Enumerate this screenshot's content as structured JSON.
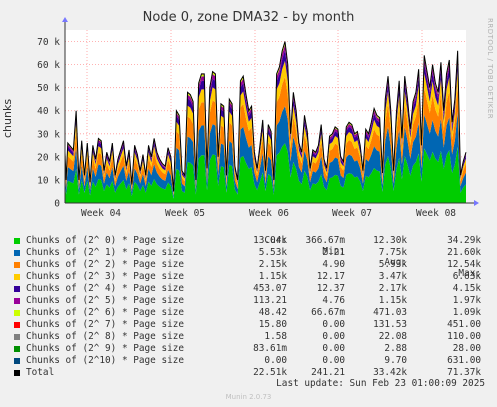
{
  "chart_data": {
    "type": "area",
    "title": "Node 0, zone DMA32 - by month",
    "ylabel": "chunks",
    "xlabels": [
      "Week 04",
      "Week 05",
      "Week 06",
      "Week 07",
      "Week 08"
    ],
    "yticks": [
      "0",
      "10 k",
      "20 k",
      "30 k",
      "40 k",
      "50 k",
      "60 k",
      "70 k"
    ],
    "ylim": [
      0,
      75000
    ],
    "grid": true,
    "stacked": true,
    "legend_headers": [
      "Cur:",
      "Min:",
      "Avg:",
      "Max:"
    ],
    "totals_peaks": [
      [
        0,
        22000
      ],
      [
        0.4,
        10000
      ],
      [
        1,
        26000
      ],
      [
        3,
        23000
      ],
      [
        4,
        40000
      ],
      [
        5,
        10000
      ],
      [
        6,
        27000
      ],
      [
        7,
        12000
      ],
      [
        8,
        26000
      ],
      [
        9,
        9000
      ],
      [
        9.6,
        19000
      ],
      [
        10,
        25000
      ],
      [
        11,
        19000
      ],
      [
        12,
        28000
      ],
      [
        13,
        27000
      ],
      [
        14,
        14000
      ],
      [
        15,
        22000
      ],
      [
        16,
        18000
      ],
      [
        17,
        26000
      ],
      [
        18,
        12000
      ],
      [
        19,
        19000
      ],
      [
        20,
        23000
      ],
      [
        21,
        27000
      ],
      [
        22,
        16000
      ],
      [
        23,
        23000
      ],
      [
        24,
        8000
      ],
      [
        25,
        25000
      ],
      [
        26,
        21000
      ],
      [
        27,
        14000
      ],
      [
        28,
        21000
      ],
      [
        29,
        12000
      ],
      [
        30,
        25000
      ],
      [
        31,
        20000
      ],
      [
        32,
        28000
      ],
      [
        33,
        22000
      ],
      [
        34,
        19000
      ],
      [
        35,
        17000
      ],
      [
        36,
        16000
      ],
      [
        37,
        24000
      ],
      [
        38,
        20000
      ],
      [
        39,
        5000
      ],
      [
        40,
        40000
      ],
      [
        41,
        38000
      ],
      [
        42,
        14000
      ],
      [
        43,
        12000
      ],
      [
        44,
        48000
      ],
      [
        45,
        47000
      ],
      [
        46,
        44000
      ],
      [
        47,
        10000
      ],
      [
        48,
        52000
      ],
      [
        49,
        56000
      ],
      [
        50,
        56000
      ],
      [
        51,
        15000
      ],
      [
        52,
        50000
      ],
      [
        53,
        57000
      ],
      [
        54,
        56000
      ],
      [
        55,
        20000
      ],
      [
        56,
        43000
      ],
      [
        57,
        42000
      ],
      [
        58,
        12000
      ],
      [
        59,
        45000
      ],
      [
        60,
        43000
      ],
      [
        61,
        16000
      ],
      [
        62,
        10000
      ],
      [
        63,
        53000
      ],
      [
        64,
        55000
      ],
      [
        65,
        47000
      ],
      [
        66,
        40000
      ],
      [
        67,
        42000
      ],
      [
        68,
        22000
      ],
      [
        69,
        15000
      ],
      [
        70,
        25000
      ],
      [
        71,
        36000
      ],
      [
        72,
        14000
      ],
      [
        73,
        34000
      ],
      [
        74,
        31000
      ],
      [
        75,
        10000
      ],
      [
        76,
        56000
      ],
      [
        77,
        59000
      ],
      [
        78,
        66000
      ],
      [
        79,
        70000
      ],
      [
        80,
        60000
      ],
      [
        81,
        30000
      ],
      [
        82,
        48000
      ],
      [
        83,
        40000
      ],
      [
        84,
        26000
      ],
      [
        85,
        22000
      ],
      [
        86,
        38000
      ],
      [
        87,
        31000
      ],
      [
        88,
        15000
      ],
      [
        89,
        23000
      ],
      [
        90,
        22000
      ],
      [
        91,
        25000
      ],
      [
        92,
        34000
      ],
      [
        93,
        19000
      ],
      [
        94,
        15000
      ],
      [
        95,
        29000
      ],
      [
        96,
        30000
      ],
      [
        97,
        33000
      ],
      [
        98,
        32000
      ],
      [
        99,
        20000
      ],
      [
        100,
        18000
      ],
      [
        101,
        33000
      ],
      [
        102,
        35000
      ],
      [
        103,
        34000
      ],
      [
        104,
        30000
      ],
      [
        105,
        31000
      ],
      [
        106,
        25000
      ],
      [
        107,
        14000
      ],
      [
        108,
        32000
      ],
      [
        109,
        30000
      ],
      [
        110,
        35000
      ],
      [
        111,
        41000
      ],
      [
        112,
        38000
      ],
      [
        113,
        37000
      ],
      [
        114,
        13000
      ],
      [
        115,
        45000
      ],
      [
        116,
        55000
      ],
      [
        117,
        40000
      ],
      [
        118,
        14000
      ],
      [
        119,
        39000
      ],
      [
        120,
        53000
      ],
      [
        121,
        28000
      ],
      [
        122,
        55000
      ],
      [
        123,
        45000
      ],
      [
        124,
        32000
      ],
      [
        125,
        44000
      ],
      [
        126,
        48000
      ],
      [
        127,
        58000
      ],
      [
        128,
        25000
      ],
      [
        129,
        64000
      ],
      [
        130,
        57000
      ],
      [
        131,
        50000
      ],
      [
        132,
        60000
      ],
      [
        133,
        52000
      ],
      [
        134,
        48000
      ],
      [
        135,
        61000
      ],
      [
        136,
        40000
      ],
      [
        137,
        56000
      ],
      [
        138,
        62000
      ],
      [
        139,
        35000
      ],
      [
        140,
        45000
      ],
      [
        141,
        66000
      ],
      [
        142,
        12000
      ],
      [
        143,
        18000
      ],
      [
        144,
        22000
      ]
    ],
    "series": [
      {
        "name": "Chunks of (2^ 0) * Page size",
        "color": "#00cc00",
        "cur": "13.04k",
        "min": "366.67m",
        "avg": "12.30k",
        "max": "34.29k"
      },
      {
        "name": "Chunks of (2^ 1) * Page size",
        "color": "#0066b3",
        "cur": "5.53k",
        "min": "2.21",
        "avg": "7.75k",
        "max": "21.60k"
      },
      {
        "name": "Chunks of (2^ 2) * Page size",
        "color": "#ff8000",
        "cur": "2.15k",
        "min": "4.90",
        "avg": "5.93k",
        "max": "12.54k"
      },
      {
        "name": "Chunks of (2^ 3) * Page size",
        "color": "#ffcc00",
        "cur": "1.15k",
        "min": "12.17",
        "avg": "3.47k",
        "max": "6.63k"
      },
      {
        "name": "Chunks of (2^ 4) * Page size",
        "color": "#330099",
        "cur": "453.07",
        "min": "12.37",
        "avg": "2.17k",
        "max": "4.15k"
      },
      {
        "name": "Chunks of (2^ 5) * Page size",
        "color": "#990099",
        "cur": "113.21",
        "min": "4.76",
        "avg": "1.15k",
        "max": "1.97k"
      },
      {
        "name": "Chunks of (2^ 6) * Page size",
        "color": "#ccff00",
        "cur": "48.42",
        "min": "66.67m",
        "avg": "471.03",
        "max": "1.09k"
      },
      {
        "name": "Chunks of (2^ 7) * Page size",
        "color": "#ff0000",
        "cur": "15.80",
        "min": "0.00",
        "avg": "131.53",
        "max": "451.00"
      },
      {
        "name": "Chunks of (2^ 8) * Page size",
        "color": "#808080",
        "cur": "1.58",
        "min": "0.00",
        "avg": "22.08",
        "max": "110.00"
      },
      {
        "name": "Chunks of (2^ 9) * Page size",
        "color": "#008f00",
        "cur": "83.61m",
        "min": "0.00",
        "avg": "2.88",
        "max": "28.00"
      },
      {
        "name": "Chunks of (2^10) * Page size",
        "color": "#00487d",
        "cur": "0.00",
        "min": "0.00",
        "avg": "9.70",
        "max": "631.00"
      },
      {
        "name": "Total",
        "color": "#000000",
        "cur": "22.51k",
        "min": "241.21",
        "avg": "33.42k",
        "max": "71.37k"
      }
    ]
  },
  "footer": {
    "last_update": "Last update: Sun Feb 23 01:00:09 2025",
    "version": "Munin 2.0.73",
    "side_label": "RRDTOOL / TOBI OETIKER"
  }
}
